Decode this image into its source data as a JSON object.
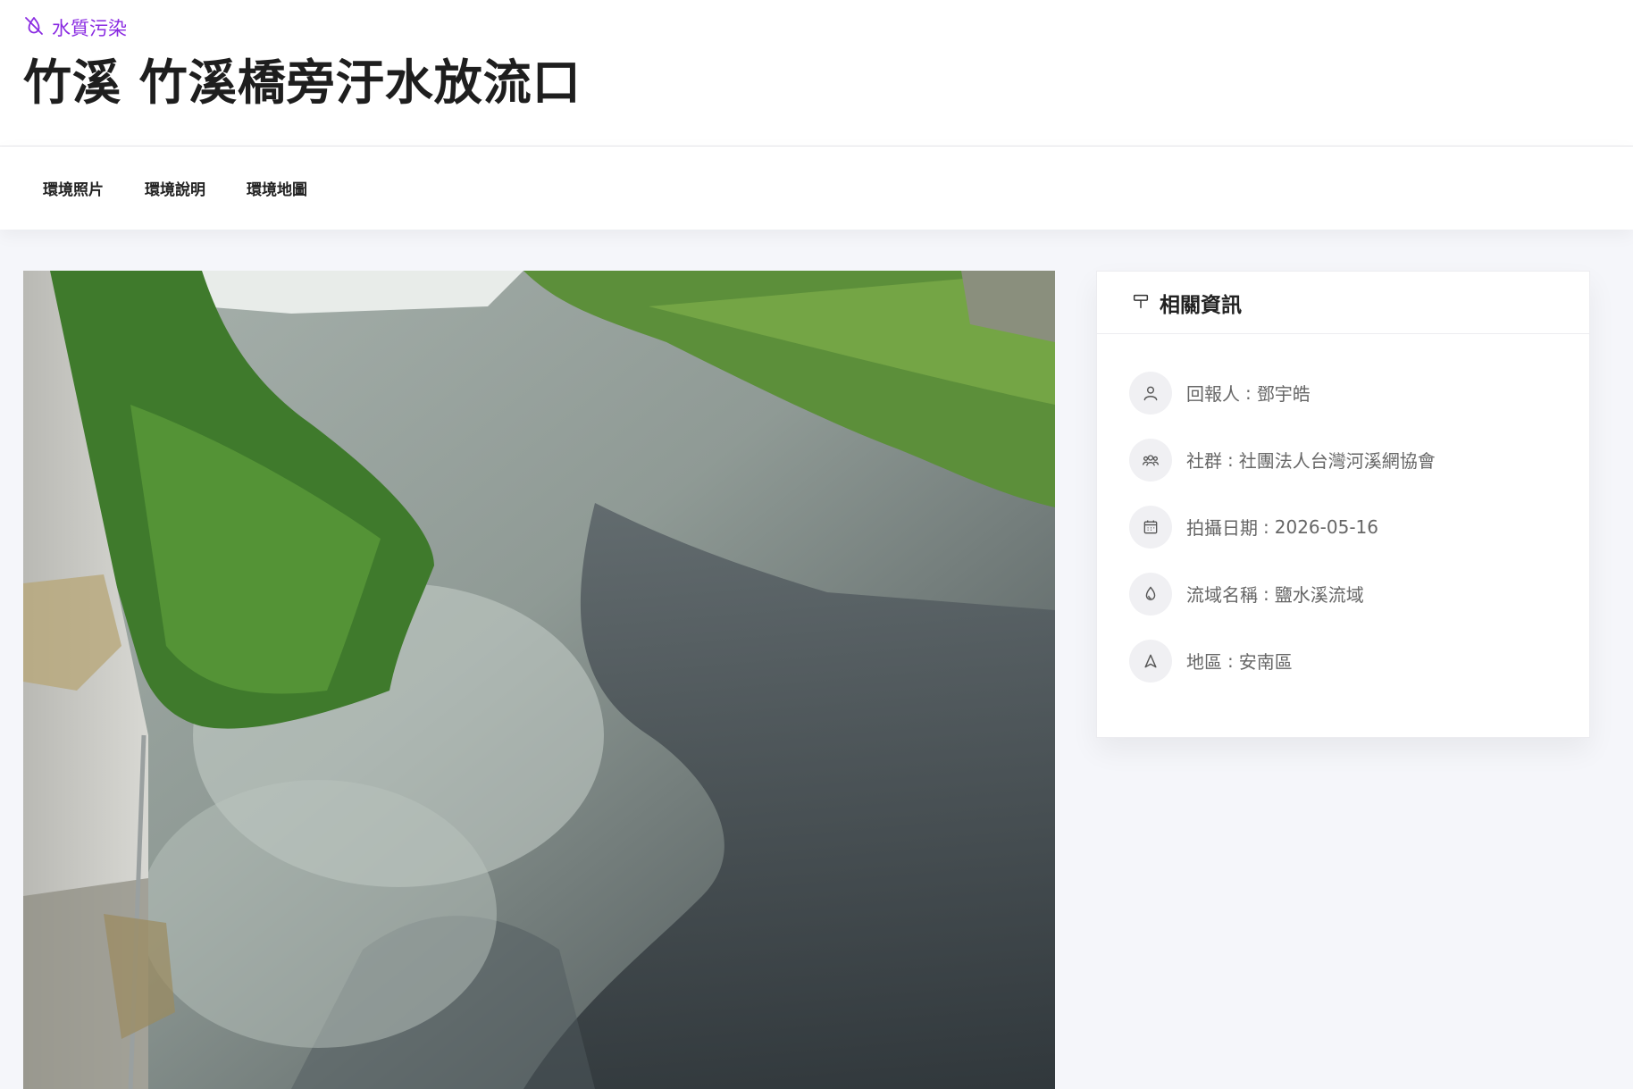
{
  "header": {
    "category": "水質污染",
    "category_icon": "water-drop-off-icon",
    "title": "竹溪 竹溪橋旁汙水放流口"
  },
  "tabs": [
    {
      "label": "環境照片"
    },
    {
      "label": "環境說明"
    },
    {
      "label": "環境地圖"
    }
  ],
  "info": {
    "title": "相關資訊",
    "title_icon": "pin-icon",
    "items": [
      {
        "icon": "user-icon",
        "label": "回報人",
        "value": "鄧宇皓"
      },
      {
        "icon": "group-icon",
        "label": "社群",
        "value": "社團法人台灣河溪網協會"
      },
      {
        "icon": "calendar-icon",
        "label": "拍攝日期",
        "value": "2026-05-16"
      },
      {
        "icon": "water-drop-icon",
        "label": "流域名稱",
        "value": "鹽水溪流域"
      },
      {
        "icon": "location-arrow-icon",
        "label": "地區",
        "value": "安南區"
      }
    ]
  },
  "colors": {
    "accent": "#8a2be2",
    "background": "#f5f6fa"
  }
}
